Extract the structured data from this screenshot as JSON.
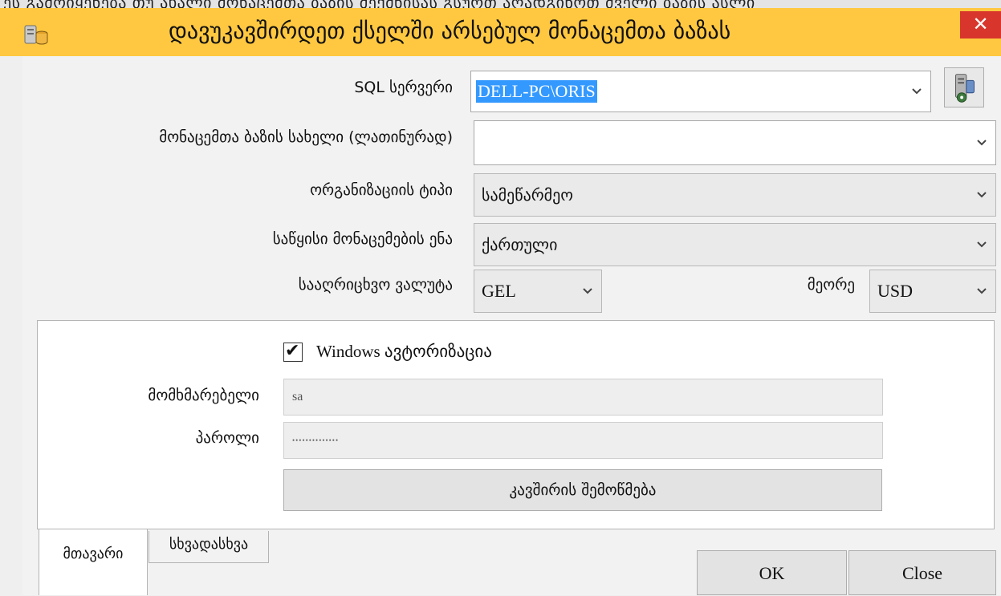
{
  "top_strip_text": "ეს გამოიყენება თუ ახალი მონაცემთა ბაზის შექმნისას გსურთ აღადგინოთ ძველი ბაზის ასლი",
  "window": {
    "title": "დავუკავშირდეთ ქსელში არსებულ მონაცემთა ბაზას",
    "close_label": "✕",
    "title_bar_color": "#ffc840"
  },
  "form": {
    "sql_server": {
      "label": "SQL სერვერი",
      "value": "DELL-PC\\ORIS"
    },
    "db_name": {
      "label": "მონაცემთა ბაზის სახელი (ლათინურად)",
      "value": ""
    },
    "org_type": {
      "label": "ორგანიზაციის ტიპი",
      "value": "სამეწარმეო"
    },
    "initial_language": {
      "label": "საწყისი მონაცემების ენა",
      "value": "ქართული"
    },
    "currency": {
      "label": "სააღრიცხვო ვალუტა",
      "value": "GEL"
    },
    "second_currency": {
      "label": "მეორე",
      "value": "USD"
    }
  },
  "auth": {
    "windows_auth": {
      "label": "Windows ავტორიზაცია",
      "checked": true,
      "check_glyph": "✔"
    },
    "user": {
      "label": "მომხმარებელი",
      "value": "sa"
    },
    "password": {
      "label": "პაროლი",
      "value": "••••••••••••••"
    },
    "test_button_label": "კავშირის შემოწმება"
  },
  "tabs": [
    {
      "label": "მთავარი",
      "active": true
    },
    {
      "label": "სხვადასხვა",
      "active": false
    }
  ],
  "buttons": {
    "ok": "OK",
    "close": "Close"
  },
  "icons": {
    "app": "database-server-icon",
    "tool": "server-setup-icon",
    "dropdown": "chevron-down-icon"
  }
}
